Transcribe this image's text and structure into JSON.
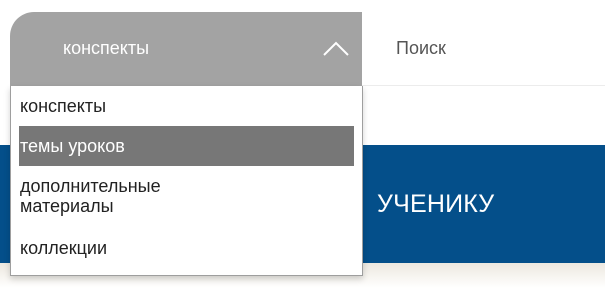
{
  "select": {
    "value": "конспекты",
    "icon": "chevron-up-icon",
    "options": [
      {
        "label": "конспекты",
        "selected": false
      },
      {
        "label": "темы уроков",
        "highlighted": true
      },
      {
        "label": "дополнительные\nматериалы",
        "selected": false
      },
      {
        "label": "коллекции",
        "selected": false
      }
    ]
  },
  "search": {
    "placeholder": "Поиск"
  },
  "banner": {
    "label": "УЧЕНИКУ"
  },
  "colors": {
    "select_bg": "#a3a3a3",
    "highlight_bg": "#777777",
    "banner_bg": "#044f8a"
  }
}
